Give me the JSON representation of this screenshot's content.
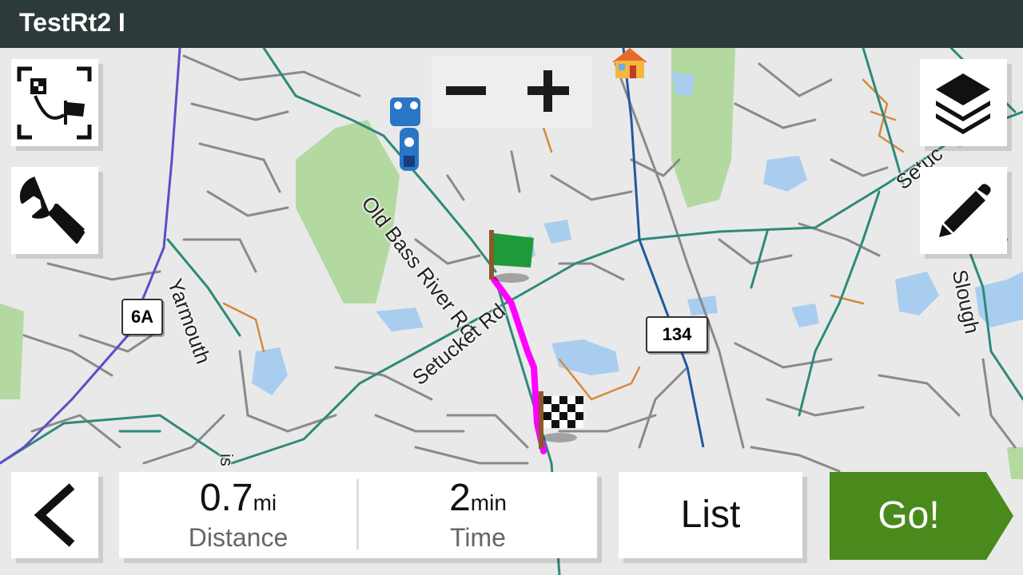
{
  "title": "TestRt2 I",
  "map": {
    "road_labels": {
      "bass_river": "Old Bass River Rd",
      "setucket": "Setucket Rd",
      "yarmouth": "Yarmouth",
      "setuc_ne": "Setuc",
      "slough": "Slough",
      "bottom_partial": "is"
    },
    "shields": {
      "route_6a": "6A",
      "route_134": "134"
    },
    "route_color": "#ff00ff"
  },
  "controls": {
    "zoom_out_icon": "minus-icon",
    "zoom_in_icon": "plus-icon",
    "route_overview_icon": "route-overview-icon",
    "tools_icon": "wrench-icon",
    "layers_icon": "layers-icon",
    "edit_icon": "pencil-icon",
    "back_icon": "chevron-left-icon"
  },
  "stats": {
    "distance": {
      "value": "0.7",
      "unit": "mi",
      "label": "Distance"
    },
    "time": {
      "value": "2",
      "unit": "min",
      "label": "Time"
    }
  },
  "actions": {
    "list_label": "List",
    "go_label": "Go!"
  },
  "colors": {
    "title_bar": "#2c3a3a",
    "go_button": "#4a8a1c",
    "water": "#a9cdee",
    "park": "#b3d9a0"
  }
}
